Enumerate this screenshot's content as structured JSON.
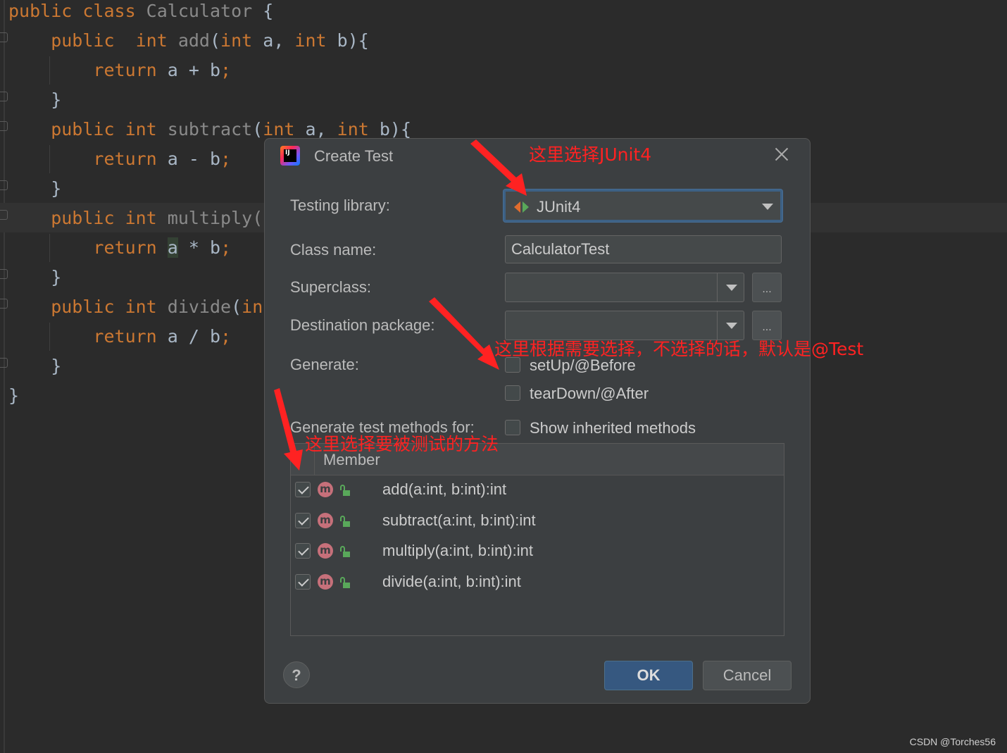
{
  "editor": {
    "lines": [
      {
        "parts": [
          {
            "t": "public class ",
            "c": "kw"
          },
          {
            "t": "Calculator",
            "c": "dim"
          },
          {
            "t": " {",
            "c": ""
          }
        ]
      },
      {
        "parts": [
          {
            "t": "    public  int ",
            "c": "kw"
          },
          {
            "t": "add",
            "c": "dim"
          },
          {
            "t": "(",
            "c": ""
          },
          {
            "t": "int ",
            "c": "kw"
          },
          {
            "t": "a, ",
            "c": ""
          },
          {
            "t": "int ",
            "c": "kw"
          },
          {
            "t": "b){",
            "c": ""
          }
        ]
      },
      {
        "parts": [
          {
            "t": "        return ",
            "c": "kw"
          },
          {
            "t": "a + b",
            "c": ""
          },
          {
            "t": ";",
            "c": "kw"
          }
        ]
      },
      {
        "parts": [
          {
            "t": "    }",
            "c": ""
          }
        ]
      },
      {
        "parts": [
          {
            "t": "    public int ",
            "c": "kw"
          },
          {
            "t": "subtract",
            "c": "dim"
          },
          {
            "t": "(",
            "c": ""
          },
          {
            "t": "int ",
            "c": "kw"
          },
          {
            "t": "a, ",
            "c": ""
          },
          {
            "t": "int ",
            "c": "kw"
          },
          {
            "t": "b){",
            "c": ""
          }
        ]
      },
      {
        "parts": [
          {
            "t": "        return ",
            "c": "kw"
          },
          {
            "t": "a - b",
            "c": ""
          },
          {
            "t": ";",
            "c": "kw"
          }
        ]
      },
      {
        "parts": [
          {
            "t": "    }",
            "c": ""
          }
        ]
      },
      {
        "parts": [
          {
            "t": "    public int ",
            "c": "kw"
          },
          {
            "t": "multiply",
            "c": "dim"
          },
          {
            "t": "(i",
            "c": "dim"
          }
        ]
      },
      {
        "parts": [
          {
            "t": "        return ",
            "c": "kw"
          },
          {
            "t": "a",
            "c": "hl"
          },
          {
            "t": " * b",
            "c": ""
          },
          {
            "t": ";",
            "c": "kw"
          }
        ]
      },
      {
        "parts": [
          {
            "t": "    }",
            "c": ""
          }
        ]
      },
      {
        "parts": [
          {
            "t": "    public int ",
            "c": "kw"
          },
          {
            "t": "divide",
            "c": "dim"
          },
          {
            "t": "(",
            "c": ""
          },
          {
            "t": "in",
            "c": "kw"
          }
        ]
      },
      {
        "parts": [
          {
            "t": "        return ",
            "c": "kw"
          },
          {
            "t": "a / b",
            "c": ""
          },
          {
            "t": ";",
            "c": "kw"
          }
        ]
      },
      {
        "parts": [
          {
            "t": "    }",
            "c": ""
          }
        ]
      },
      {
        "parts": [
          {
            "t": "}",
            "c": ""
          }
        ]
      }
    ]
  },
  "dialog": {
    "title": "Create Test",
    "testing_library_label": "Testing library:",
    "testing_library_value": "JUnit4",
    "class_name_label": "Class name:",
    "class_name_value": "CalculatorTest",
    "superclass_label": "Superclass:",
    "superclass_value": "",
    "destination_label": "Destination package:",
    "destination_value": "",
    "browse_label": "...",
    "generate_label": "Generate:",
    "setup_label": "setUp/@Before",
    "setup_checked": false,
    "teardown_label": "tearDown/@After",
    "teardown_checked": false,
    "methods_for_label": "Generate test methods for:",
    "show_inherited_label": "Show inherited methods",
    "show_inherited_checked": false,
    "member_header": "Member",
    "member_icon_letter": "m",
    "members": [
      {
        "signature": "add(a:int, b:int):int",
        "checked": true
      },
      {
        "signature": "subtract(a:int, b:int):int",
        "checked": true
      },
      {
        "signature": "multiply(a:int, b:int):int",
        "checked": true
      },
      {
        "signature": "divide(a:int, b:int):int",
        "checked": true
      }
    ],
    "help_label": "?",
    "ok_label": "OK",
    "cancel_label": "Cancel"
  },
  "annotations": {
    "junit": "这里选择JUnit4",
    "generate": "这里根据需要选择，不选择的话，默认是@Test",
    "methods": "这里选择要被测试的方法",
    "color": "#ff2222"
  },
  "watermark": "CSDN @Torches56",
  "colors": {
    "editor_bg": "#2b2b2b",
    "keyword": "#cc7832",
    "dialog_bg": "#3c3f41",
    "ok_button": "#365880",
    "focus": "#3d6185"
  }
}
